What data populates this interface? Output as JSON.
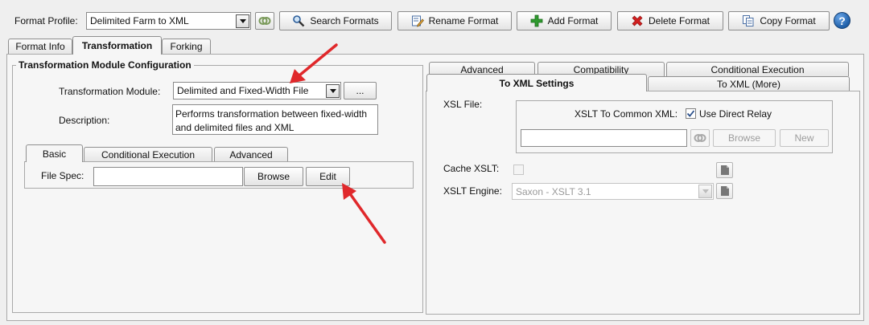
{
  "toolbar": {
    "format_profile_label": "Format Profile:",
    "format_profile_value": "Delimited Farm to XML",
    "search_formats": "Search Formats",
    "rename_format": "Rename Format",
    "add_format": "Add Format",
    "delete_format": "Delete Format",
    "copy_format": "Copy Format",
    "help_glyph": "?"
  },
  "main_tabs": [
    "Format Info",
    "Transformation",
    "Forking"
  ],
  "left_panel": {
    "title": "Transformation Module Configuration",
    "module_label": "Transformation Module:",
    "module_value": "Delimited and Fixed-Width File",
    "ellipsis": "...",
    "description_label": "Description:",
    "description_lines": [
      "Performs transformation between fixed-width",
      "and delimited files and XML"
    ],
    "sub_tabs": [
      "Basic",
      "Conditional Execution",
      "Advanced"
    ],
    "file_spec_label": "File Spec:",
    "file_spec_value": "",
    "browse": "Browse",
    "edit": "Edit"
  },
  "right_panel": {
    "back_tabs": [
      "Advanced",
      "Compatibility",
      "Conditional Execution"
    ],
    "front_tabs": [
      "To XML Settings",
      "To XML (More)"
    ],
    "xsl_file_label": "XSL File:",
    "xslt_common_label": "XSLT To Common XML:",
    "use_direct_relay": "Use Direct Relay",
    "use_direct_relay_checked": true,
    "xsl_path_value": "",
    "browse": "Browse",
    "new": "New",
    "cache_xslt_label": "Cache XSLT:",
    "cache_xslt_checked": false,
    "xslt_engine_label": "XSLT Engine:",
    "xslt_engine_value": "Saxon - XSLT 3.1"
  },
  "colors": {
    "annotation_arrow": "#e0282b",
    "help_blue": "#1f5fa8",
    "add_green": "#2f9a2f",
    "delete_red": "#d32020"
  }
}
